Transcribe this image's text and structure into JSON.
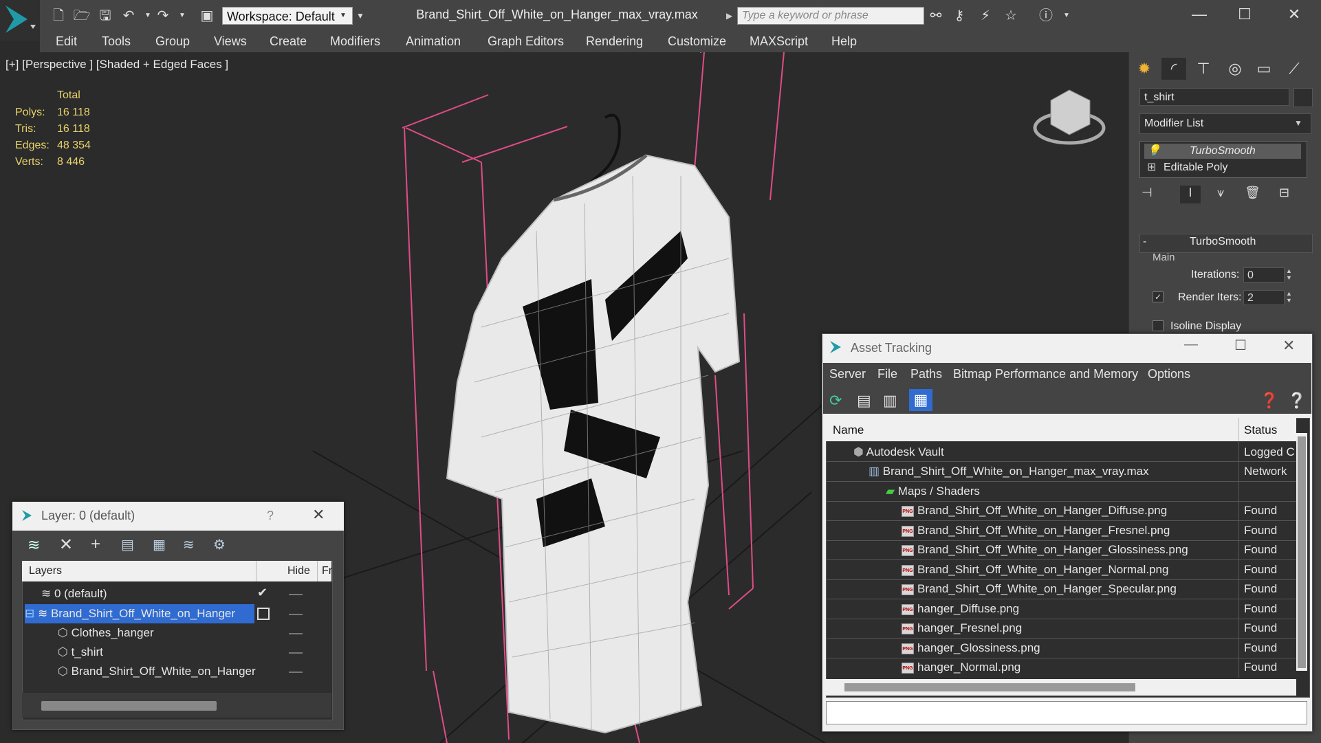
{
  "app": {
    "document_title": "Brand_Shirt_Off_White_on_Hanger_max_vray.max",
    "workspace_label": "Workspace: Default",
    "search_placeholder": "Type a keyword or phrase"
  },
  "menu": [
    "Edit",
    "Tools",
    "Group",
    "Views",
    "Create",
    "Modifiers",
    "Animation",
    "Graph Editors",
    "Rendering",
    "Customize",
    "MAXScript",
    "Help"
  ],
  "viewport": {
    "label": "[+] [Perspective ] [Shaded + Edged Faces ]",
    "stats_header": "Total",
    "stats": [
      {
        "label": "Polys:",
        "value": "16 118"
      },
      {
        "label": "Tris:",
        "value": "16 118"
      },
      {
        "label": "Edges:",
        "value": "48 354"
      },
      {
        "label": "Verts:",
        "value": "8 446"
      }
    ]
  },
  "command_panel": {
    "object_name": "t_shirt",
    "modifier_list_label": "Modifier List",
    "stack": [
      "TurboSmooth",
      "Editable Poly"
    ],
    "rollout_title": "TurboSmooth",
    "group_main": "Main",
    "iterations_label": "Iterations:",
    "iterations_value": "0",
    "render_iters_label": "Render Iters:",
    "render_iters_value": "2",
    "isoline_label": "Isoline Display"
  },
  "layer_window": {
    "title": "Layer: 0 (default)",
    "help": "?",
    "columns": [
      "Layers",
      "Hide",
      "Fr"
    ],
    "rows": [
      {
        "label": "0 (default)",
        "indent": 0
      },
      {
        "label": "Brand_Shirt_Off_White_on_Hanger",
        "indent": 0
      },
      {
        "label": "Clothes_hanger",
        "indent": 1
      },
      {
        "label": "t_shirt",
        "indent": 1
      },
      {
        "label": "Brand_Shirt_Off_White_on_Hanger",
        "indent": 1
      }
    ]
  },
  "asset_window": {
    "title": "Asset Tracking",
    "menu": [
      "Server",
      "File",
      "Paths",
      "Bitmap Performance and Memory",
      "Options"
    ],
    "columns": [
      "Name",
      "Status"
    ],
    "rows": [
      {
        "name": "Autodesk Vault",
        "status": "Logged C",
        "level": 0
      },
      {
        "name": "Brand_Shirt_Off_White_on_Hanger_max_vray.max",
        "status": "Network",
        "level": 1
      },
      {
        "name": "Maps / Shaders",
        "status": "",
        "level": 2
      },
      {
        "name": "Brand_Shirt_Off_White_on_Hanger_Diffuse.png",
        "status": "Found",
        "level": 3
      },
      {
        "name": "Brand_Shirt_Off_White_on_Hanger_Fresnel.png",
        "status": "Found",
        "level": 3
      },
      {
        "name": "Brand_Shirt_Off_White_on_Hanger_Glossiness.png",
        "status": "Found",
        "level": 3
      },
      {
        "name": "Brand_Shirt_Off_White_on_Hanger_Normal.png",
        "status": "Found",
        "level": 3
      },
      {
        "name": "Brand_Shirt_Off_White_on_Hanger_Specular.png",
        "status": "Found",
        "level": 3
      },
      {
        "name": "hanger_Diffuse.png",
        "status": "Found",
        "level": 3
      },
      {
        "name": "hanger_Fresnel.png",
        "status": "Found",
        "level": 3
      },
      {
        "name": "hanger_Glossiness.png",
        "status": "Found",
        "level": 3
      },
      {
        "name": "hanger_Normal.png",
        "status": "Found",
        "level": 3
      }
    ]
  },
  "colors": {
    "accent": "#2f6bd0",
    "stat_yellow": "#e8d36a",
    "guide_pink": "#e04c86"
  }
}
